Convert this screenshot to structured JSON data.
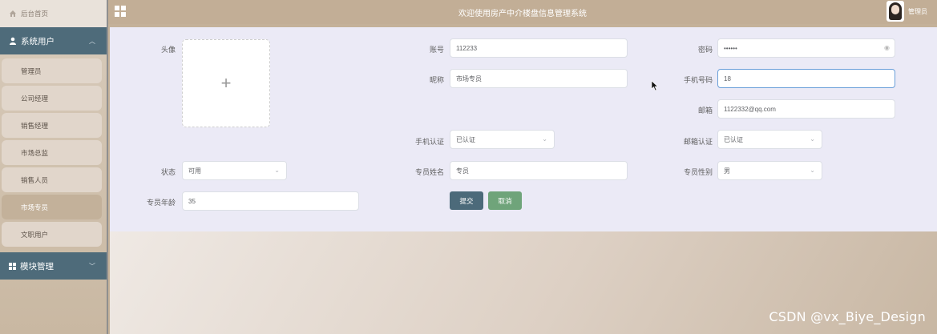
{
  "sidebar": {
    "home_label": "后台首页",
    "group1_label": "系统用户",
    "items": [
      {
        "label": "管理员"
      },
      {
        "label": "公司经理"
      },
      {
        "label": "销售经理"
      },
      {
        "label": "市场总监"
      },
      {
        "label": "销售人员"
      },
      {
        "label": "市场专员",
        "active": true
      },
      {
        "label": "文职用户"
      }
    ],
    "group2_label": "模块管理"
  },
  "header": {
    "title": "欢迎使用房产中介楼盘信息管理系统",
    "user_label": "管理员"
  },
  "form": {
    "avatar_label": "头像",
    "upload_plus": "+",
    "account_label": "账号",
    "account_value": "112233",
    "password_label": "密码",
    "password_value": "••••••",
    "nickname_label": "昵称",
    "nickname_value": "市场专员",
    "phone_label": "手机号码",
    "phone_value": "18",
    "email_label": "邮箱",
    "email_value": "1122332@qq.com",
    "phone_verify_label": "手机认证",
    "phone_verify_value": "已认证",
    "email_verify_label": "邮箱认证",
    "email_verify_value": "已认证",
    "status_label": "状态",
    "status_value": "可用",
    "name_label": "专员姓名",
    "name_value": "专员",
    "gender_label": "专员性别",
    "gender_value": "男",
    "age_label": "专员年龄",
    "age_value": "35",
    "submit_label": "提交",
    "cancel_label": "取消"
  },
  "watermark": "CSDN @vx_Biye_Design",
  "colors": {
    "sidebar_group": "#4e6b7a",
    "topbar": "#c2ae96",
    "submit_button": "#4c6a7a",
    "cancel_button": "#6fa47a"
  }
}
